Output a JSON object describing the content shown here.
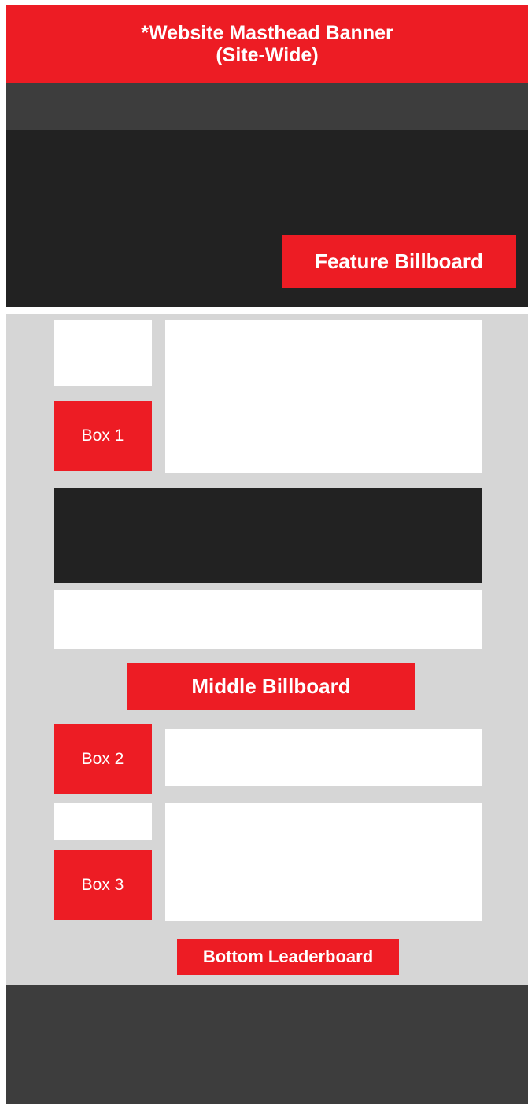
{
  "masthead": {
    "line1": "*Website Masthead Banner",
    "line2": "(Site-Wide)"
  },
  "feature_billboard": {
    "label": "Feature Billboard"
  },
  "box1": {
    "label": "Box 1"
  },
  "middle_billboard": {
    "label": "Middle Billboard"
  },
  "box2": {
    "label": "Box 2"
  },
  "box3": {
    "label": "Box 3"
  },
  "bottom_leaderboard": {
    "label": "Bottom Leaderboard"
  },
  "colors": {
    "ad_red": "#ed1c24",
    "dark": "#222222",
    "nav_gray": "#3d3d3d",
    "content_bg": "#d6d6d6",
    "placeholder": "#ffffff"
  }
}
